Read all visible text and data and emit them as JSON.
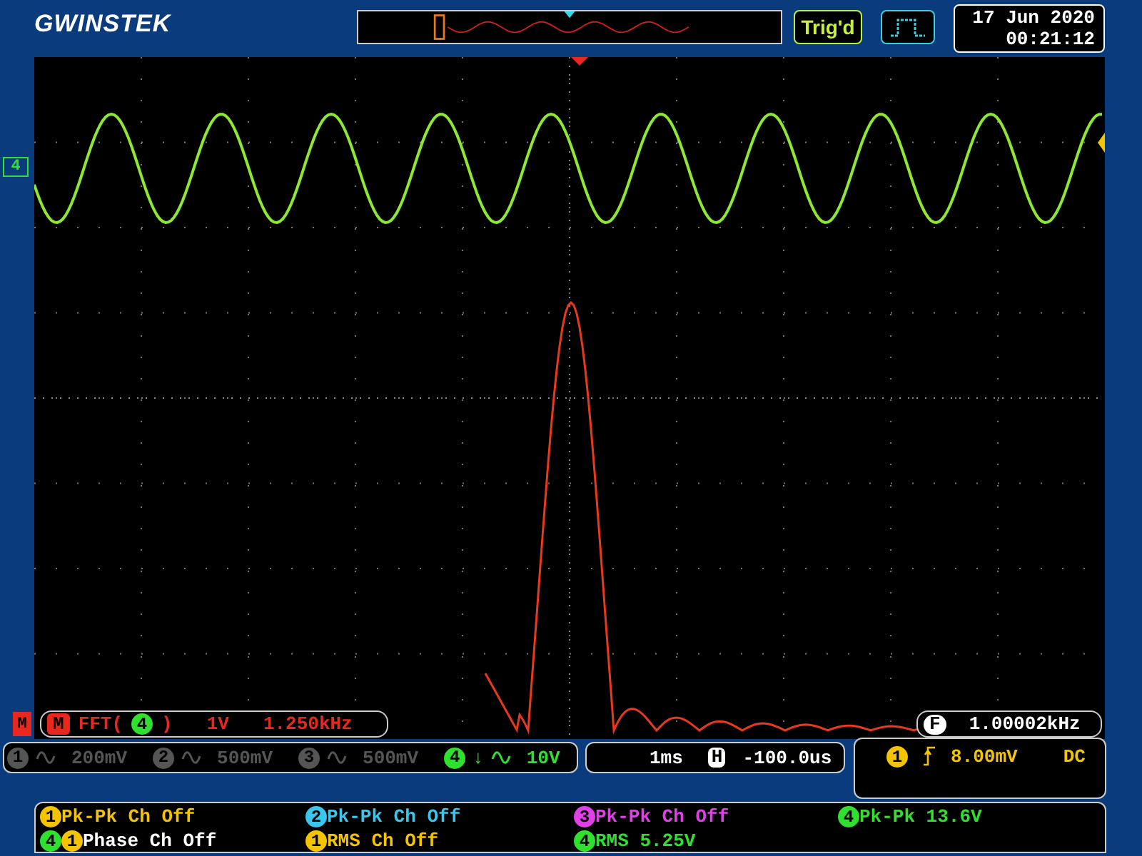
{
  "header": {
    "logo": "GWINSTEK",
    "trigger_status": "Trig'd",
    "date": "17 Jun 2020",
    "time": "00:21:12"
  },
  "channel_marker": "4",
  "math": {
    "marker": "M",
    "badge": "M",
    "function": "FFT(",
    "source": "4",
    "close": ")",
    "scale": "1V",
    "center": "1.250kHz"
  },
  "frequency": {
    "badge": "F",
    "value": "1.00002kHz"
  },
  "channels": [
    {
      "number": "1",
      "scale": "200mV",
      "on": false
    },
    {
      "number": "2",
      "scale": "500mV",
      "on": false
    },
    {
      "number": "3",
      "scale": "500mV",
      "on": false
    },
    {
      "number": "4",
      "flag": "↓",
      "scale": "10V",
      "on": true,
      "color": "#2fe02f"
    }
  ],
  "timebase": {
    "scale": "1ms",
    "badge": "H",
    "position": "-100.0us"
  },
  "trigger": {
    "source": "1",
    "level": "8.00mV",
    "coupling": "DC"
  },
  "measurements": [
    {
      "sources": [
        {
          "number": "1",
          "color": "#f5c400"
        }
      ],
      "label": "Pk-Pk Ch Off",
      "color": "#f5c400"
    },
    {
      "sources": [
        {
          "number": "2",
          "color": "#38c8ee"
        }
      ],
      "label": "Pk-Pk Ch Off",
      "color": "#38c8ee"
    },
    {
      "sources": [
        {
          "number": "3",
          "color": "#e040e8"
        }
      ],
      "label": "Pk-Pk Ch Off",
      "color": "#e040e8"
    },
    {
      "sources": [
        {
          "number": "4",
          "color": "#2fe02f"
        }
      ],
      "label": "Pk-Pk 13.6V",
      "color": "#2fe02f"
    },
    {
      "sources": [
        {
          "number": "4",
          "color": "#2fe02f"
        },
        {
          "number": "1",
          "color": "#f5c400"
        }
      ],
      "label": "Phase Ch Off",
      "color": "#ffffff"
    },
    {
      "sources": [
        {
          "number": "1",
          "color": "#f5c400"
        }
      ],
      "label": "RMS Ch Off",
      "color": "#f5c400"
    },
    {
      "sources": [
        {
          "number": "4",
          "color": "#2fe02f"
        }
      ],
      "label": "RMS 5.25V",
      "color": "#2fe02f"
    }
  ]
}
